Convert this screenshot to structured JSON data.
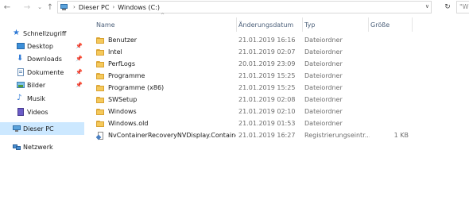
{
  "address_bar": {
    "back_icon": "arrow-left-icon",
    "forward_icon": "arrow-right-icon",
    "recent_icon": "chevron-down-icon",
    "up_icon": "arrow-up-icon",
    "breadcrumbs": [
      "Dieser PC",
      "Windows (C:)"
    ],
    "search_text": "\"Wi"
  },
  "sidebar": {
    "items": [
      {
        "label": "Schnellzugriff",
        "icon": "star-icon",
        "pinned": false
      },
      {
        "label": "Desktop",
        "icon": "desktop-folder-icon",
        "pinned": true
      },
      {
        "label": "Downloads",
        "icon": "downloads-folder-icon",
        "pinned": true
      },
      {
        "label": "Dokumente",
        "icon": "documents-folder-icon",
        "pinned": true
      },
      {
        "label": "Bilder",
        "icon": "pictures-folder-icon",
        "pinned": true
      },
      {
        "label": "Musik",
        "icon": "music-folder-icon",
        "pinned": false
      },
      {
        "label": "Videos",
        "icon": "videos-folder-icon",
        "pinned": false
      },
      {
        "label": "Dieser PC",
        "icon": "computer-icon",
        "pinned": false,
        "selected": true
      },
      {
        "label": "Netzwerk",
        "icon": "network-icon",
        "pinned": false
      }
    ]
  },
  "columns": {
    "name": "Name",
    "date": "Änderungsdatum",
    "type": "Typ",
    "size": "Größe"
  },
  "files": [
    {
      "name": "Benutzer",
      "date": "21.01.2019 16:16",
      "type": "Dateiordner",
      "size": "",
      "icon": "folder-icon"
    },
    {
      "name": "Intel",
      "date": "21.01.2019 02:07",
      "type": "Dateiordner",
      "size": "",
      "icon": "folder-icon"
    },
    {
      "name": "PerfLogs",
      "date": "20.01.2019 23:09",
      "type": "Dateiordner",
      "size": "",
      "icon": "folder-icon"
    },
    {
      "name": "Programme",
      "date": "21.01.2019 15:25",
      "type": "Dateiordner",
      "size": "",
      "icon": "folder-icon"
    },
    {
      "name": "Programme (x86)",
      "date": "21.01.2019 15:25",
      "type": "Dateiordner",
      "size": "",
      "icon": "folder-icon"
    },
    {
      "name": "SWSetup",
      "date": "21.01.2019 02:08",
      "type": "Dateiordner",
      "size": "",
      "icon": "folder-icon"
    },
    {
      "name": "Windows",
      "date": "21.01.2019 02:10",
      "type": "Dateiordner",
      "size": "",
      "icon": "folder-icon"
    },
    {
      "name": "Windows.old",
      "date": "21.01.2019 01:53",
      "type": "Dateiordner",
      "size": "",
      "icon": "folder-icon"
    },
    {
      "name": "NvContainerRecoveryNVDisplay.Containe...",
      "date": "21.01.2019 16:27",
      "type": "Registrierungseintr...",
      "size": "1 KB",
      "icon": "registry-file-icon"
    }
  ]
}
